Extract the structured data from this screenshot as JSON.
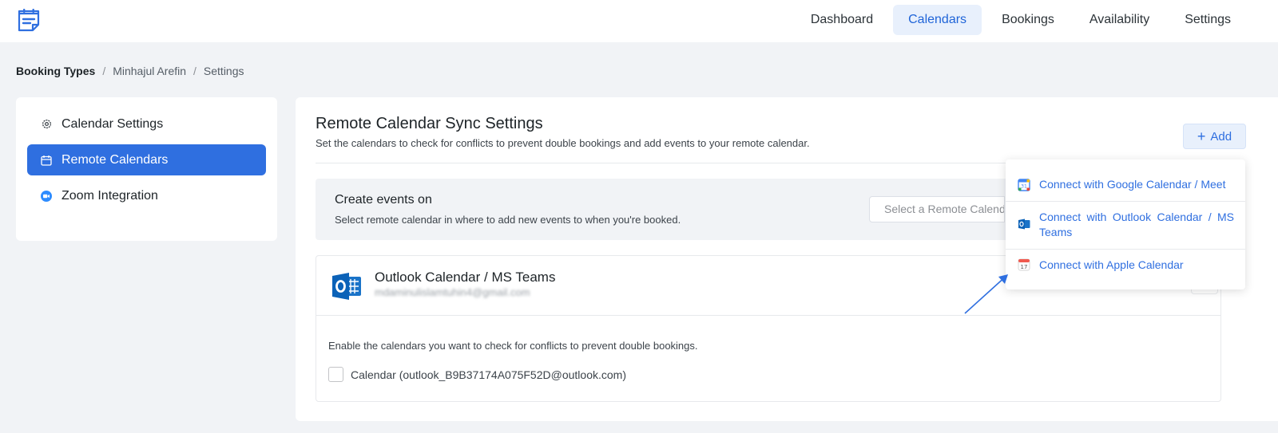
{
  "nav": {
    "logo_icon": "booking-logo-icon",
    "items": [
      {
        "label": "Dashboard",
        "active": false
      },
      {
        "label": "Calendars",
        "active": true
      },
      {
        "label": "Bookings",
        "active": false
      },
      {
        "label": "Availability",
        "active": false
      },
      {
        "label": "Settings",
        "active": false
      }
    ]
  },
  "breadcrumb": {
    "root": "Booking Types",
    "separator": "/",
    "items": [
      "Minhajul Arefin",
      "Settings"
    ]
  },
  "sidebar": {
    "items": [
      {
        "label": "Calendar Settings",
        "icon": "gear-icon",
        "active": false
      },
      {
        "label": "Remote Calendars",
        "icon": "calendar-icon",
        "active": true
      },
      {
        "label": "Zoom Integration",
        "icon": "zoom-icon",
        "active": false
      }
    ]
  },
  "main": {
    "title": "Remote Calendar Sync Settings",
    "subtitle": "Set the calendars to check for conflicts to prevent double bookings and add events to your remote calendar.",
    "add_button": {
      "icon": "plus-icon",
      "label": "Add"
    },
    "create_events": {
      "title": "Create events on",
      "description": "Select remote calendar in where to add new events to when you're booked.",
      "select_placeholder": "Select a Remote Calendar"
    },
    "account": {
      "icon": "outlook-icon",
      "name": "Outlook Calendar / MS Teams",
      "email": "mdaminulislamtuhin4@gmail.com",
      "conflict_description": "Enable the calendars you want to check for conflicts to prevent double bookings.",
      "calendars": [
        {
          "label": "Calendar (outlook_B9B37174A075F52D@outlook.com)",
          "checked": false
        }
      ]
    }
  },
  "dropdown": {
    "items": [
      {
        "label": "Connect with Google Calendar / Meet",
        "icon": "google-calendar-icon"
      },
      {
        "label": "Connect with Outlook Calendar / MS Teams",
        "icon": "outlook-icon"
      },
      {
        "label": "Connect with Apple Calendar",
        "icon": "apple-calendar-icon"
      }
    ]
  },
  "colors": {
    "accent": "#2f6fe0",
    "nav_active_bg": "#e8f0fc",
    "page_bg": "#f1f3f6"
  }
}
